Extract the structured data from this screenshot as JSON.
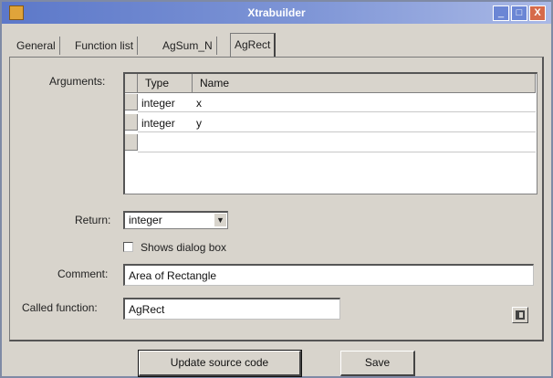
{
  "window": {
    "title": "Xtrabuilder",
    "buttons": {
      "minimize": "_",
      "maximize": "□",
      "close": "X"
    }
  },
  "tabs": [
    {
      "label": "General",
      "active": false
    },
    {
      "label": "Function list",
      "active": false
    },
    {
      "label": "AgSum_N",
      "active": false
    },
    {
      "label": "AgRect",
      "active": true
    }
  ],
  "arguments": {
    "label": "Arguments:",
    "columns": [
      "Type",
      "Name"
    ],
    "rows": [
      {
        "type": "integer",
        "name": "x"
      },
      {
        "type": "integer",
        "name": "y"
      },
      {
        "type": "",
        "name": ""
      }
    ]
  },
  "return": {
    "label": "Return:",
    "value": "integer"
  },
  "shows_dialog": {
    "label": "Shows dialog box",
    "checked": false
  },
  "comment": {
    "label": "Comment:",
    "value": "Area of Rectangle"
  },
  "called_function": {
    "label": "Called function:",
    "value": "AgRect"
  },
  "actions": {
    "update_label": "Update source code",
    "save_label": "Save"
  },
  "icons": {
    "app": "app-icon",
    "browse": "browse-icon",
    "dropdown": "chevron-down-icon"
  }
}
